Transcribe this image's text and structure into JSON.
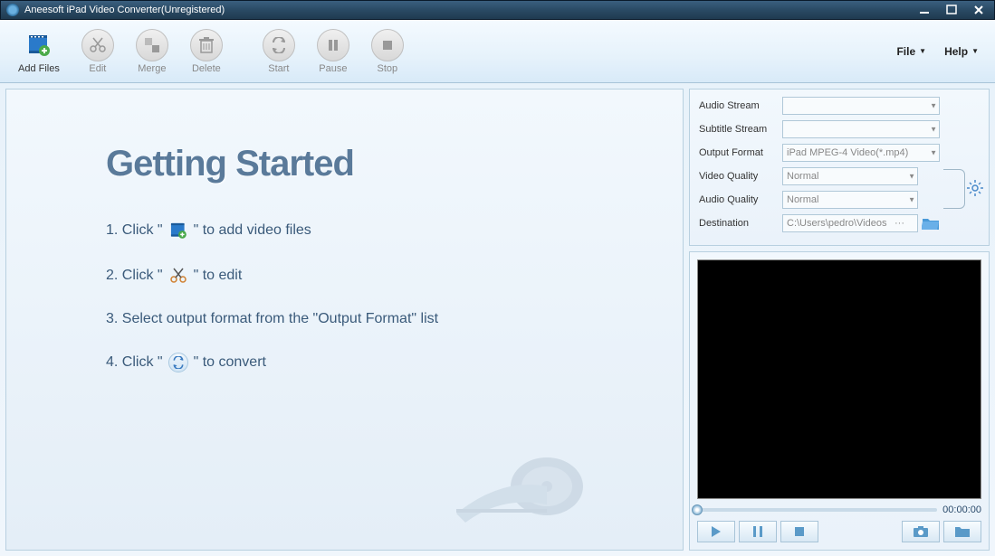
{
  "window": {
    "title": "Aneesoft iPad Video Converter(Unregistered)"
  },
  "toolbar": {
    "add_files": "Add Files",
    "edit": "Edit",
    "merge": "Merge",
    "delete": "Delete",
    "start": "Start",
    "pause": "Pause",
    "stop": "Stop"
  },
  "menus": {
    "file": "File",
    "help": "Help"
  },
  "getting_started": {
    "title": "Getting Started",
    "step1_a": "1. Click \"",
    "step1_b": "\" to add video files",
    "step2_a": "2. Click \"",
    "step2_b": "\" to edit",
    "step3": "3. Select output format from the \"Output Format\" list",
    "step4_a": "4. Click \"",
    "step4_b": "\" to convert"
  },
  "settings": {
    "audio_stream_label": "Audio Stream",
    "audio_stream_value": "",
    "subtitle_stream_label": "Subtitle Stream",
    "subtitle_stream_value": "",
    "output_format_label": "Output Format",
    "output_format_value": "iPad MPEG-4 Video(*.mp4)",
    "video_quality_label": "Video Quality",
    "video_quality_value": "Normal",
    "audio_quality_label": "Audio Quality",
    "audio_quality_value": "Normal",
    "destination_label": "Destination",
    "destination_value": "C:\\Users\\pedro\\Videos"
  },
  "player": {
    "time": "00:00:00"
  }
}
